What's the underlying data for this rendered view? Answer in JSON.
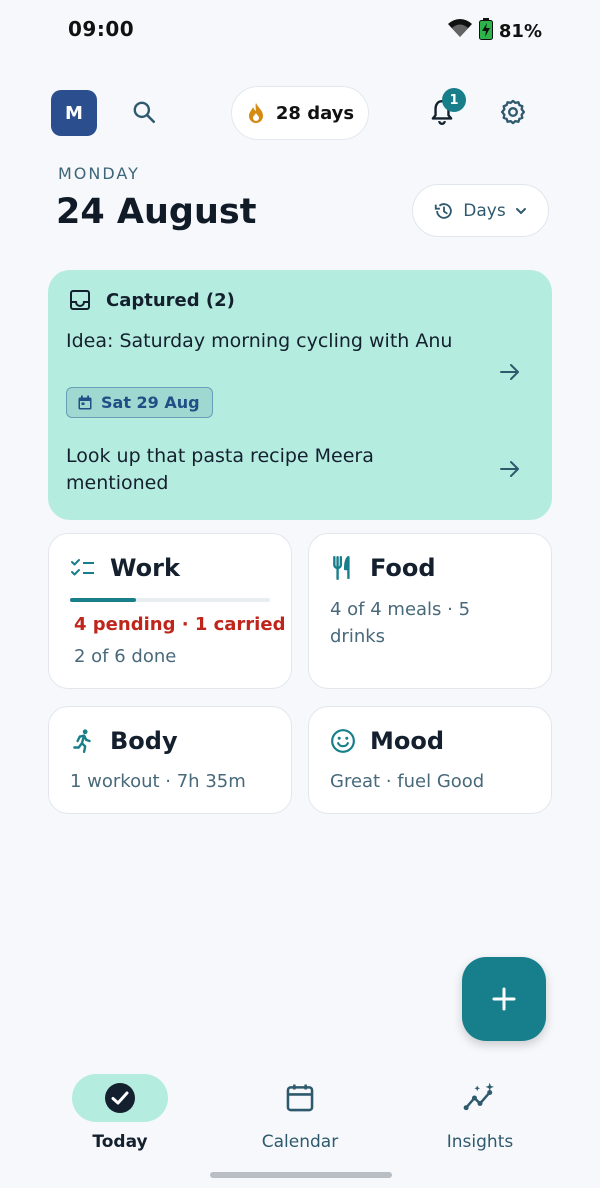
{
  "status": {
    "time": "09:00",
    "battery": "81%"
  },
  "header": {
    "avatar_initial": "M",
    "streak_label": "28 days",
    "notification_count": "1"
  },
  "day": {
    "weekday": "MONDAY",
    "date": "24 August",
    "range_selector": "Days"
  },
  "captured": {
    "title": "Captured (2)",
    "items": [
      {
        "text": "Idea: Saturday morning cycling with Anu",
        "chip": "Sat 29 Aug"
      },
      {
        "text": "Look up that pasta recipe Meera mentioned"
      }
    ]
  },
  "tiles": {
    "work": {
      "title": "Work",
      "alert": "4 pending · 1 carried",
      "summary": "2 of 6 done",
      "progress": 0.33
    },
    "food": {
      "title": "Food",
      "summary": "4 of 4 meals · 5 drinks"
    },
    "body": {
      "title": "Body",
      "summary": "1 workout · 7h 35m"
    },
    "mood": {
      "title": "Mood",
      "summary": "Great · fuel Good"
    }
  },
  "nav": {
    "items": [
      {
        "label": "Today",
        "icon": "check-circle-icon",
        "active": true
      },
      {
        "label": "Calendar",
        "icon": "calendar-icon",
        "active": false
      },
      {
        "label": "Insights",
        "icon": "insights-icon",
        "active": false
      }
    ]
  },
  "colors": {
    "accent": "#167f8b",
    "captured_bg": "#b5ece0",
    "alert": "#c0251c",
    "avatar": "#2a4e8e"
  }
}
